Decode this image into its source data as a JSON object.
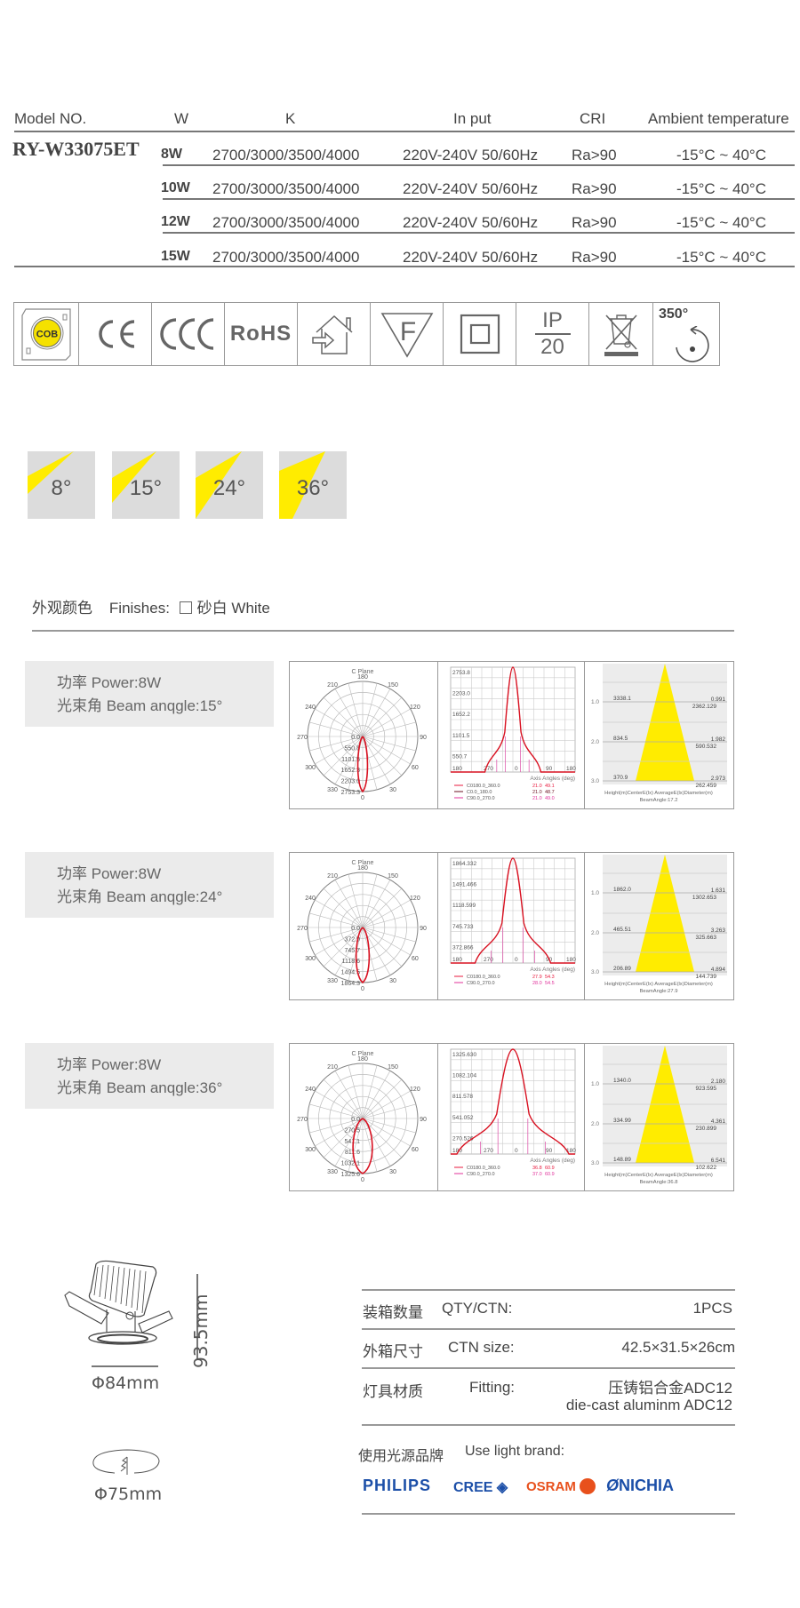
{
  "spec_table": {
    "headers": {
      "model": "Model NO.",
      "w": "W",
      "k": "K",
      "input": "In put",
      "cri": "CRI",
      "ambient": "Ambient temperature"
    },
    "model": "RY-W33075ET",
    "rows": [
      {
        "w": "8W",
        "k": "2700/3000/3500/4000",
        "input": "220V-240V 50/60Hz",
        "cri": "Ra>90",
        "ambient": "-15°C ~ 40°C"
      },
      {
        "w": "10W",
        "k": "2700/3000/3500/4000",
        "input": "220V-240V 50/60Hz",
        "cri": "Ra>90",
        "ambient": "-15°C ~ 40°C"
      },
      {
        "w": "12W",
        "k": "2700/3000/3500/4000",
        "input": "220V-240V 50/60Hz",
        "cri": "Ra>90",
        "ambient": "-15°C ~ 40°C"
      },
      {
        "w": "15W",
        "k": "2700/3000/3500/4000",
        "input": "220V-240V 50/60Hz",
        "cri": "Ra>90",
        "ambient": "-15°C ~ 40°C"
      }
    ]
  },
  "certifications": {
    "icons": [
      "cob-chip-icon",
      "ce-mark-icon",
      "ccc-mark-icon",
      "rohs-icon",
      "indoor-use-icon",
      "f-mark-icon",
      "class-ii-icon",
      "ip20-icon",
      "weee-bin-icon",
      "rotation-icon"
    ],
    "cob_text": "COB",
    "ce_text": "CE",
    "ccc_text": "CCC",
    "rohs_text": "RoHS",
    "f_text": "F",
    "ip_top": "IP",
    "ip_bottom": "20",
    "rotation_text": "350°",
    "colors": {
      "cob_yellow": "#f5e100",
      "icon_gray": "#666666"
    }
  },
  "beam_angles": [
    {
      "label": "8°",
      "angle": 8
    },
    {
      "label": "15°",
      "angle": 15
    },
    {
      "label": "24°",
      "angle": 24
    },
    {
      "label": "36°",
      "angle": 36
    }
  ],
  "finishes": {
    "cn": "外观颜色",
    "en": "Finishes:",
    "option": "砂白 White",
    "checked": false
  },
  "photometrics": [
    {
      "power": "功率 Power:8W",
      "beam": "光束角 Beam anqgle:15°",
      "polar": {
        "title": "C Plane",
        "angle_labels": [
          "180",
          "150",
          "120",
          "90",
          "60",
          "30",
          "0",
          "330",
          "300",
          "270",
          "240",
          "210"
        ],
        "rings": [
          "0.0",
          "550.8",
          "1101.5",
          "1652.3",
          "2203.0",
          "2753.3"
        ]
      },
      "curve": {
        "yticks": [
          "2753.8",
          "2203.0",
          "1652.2",
          "1101.5",
          "550.7"
        ],
        "xticks": [
          "180",
          "270",
          "0",
          "90",
          "180"
        ],
        "axis_label": "Axis Angles (deg)",
        "legend": [
          {
            "name": "C0180.0_360.0",
            "a": "21.0",
            "b": "49.1",
            "color": "#e8183c"
          },
          {
            "name": "C0.0_180.0",
            "a": "21.0",
            "b": "48.7",
            "color": "#6b1020"
          },
          {
            "name": "C90.0_270.0",
            "a": "21.0",
            "b": "49.0",
            "color": "#e0309a"
          }
        ]
      },
      "cone": {
        "rows": [
          {
            "h": "1.0",
            "center": "3338.1",
            "diam": "0.991",
            "avg": "2362.129"
          },
          {
            "h": "2.0",
            "center": "834.5",
            "diam": "1.982",
            "avg": "590.532"
          },
          {
            "h": "3.0",
            "center": "370.9",
            "diam": "2.973",
            "avg": "262.459"
          }
        ],
        "footer": "Height(m)CenterE(lx)     AverageE(lx)Diameter(m)",
        "beam_angle": "BeamAngle:17.2"
      }
    },
    {
      "power": "功率 Power:8W",
      "beam": "光束角 Beam anqgle:24°",
      "polar": {
        "title": "C Plane",
        "angle_labels": [
          "180",
          "150",
          "120",
          "90",
          "60",
          "30",
          "0",
          "330",
          "300",
          "270",
          "240",
          "210"
        ],
        "rings": [
          "0.0",
          "372.9",
          "745.7",
          "1118.6",
          "1494.5",
          "1864.3"
        ]
      },
      "curve": {
        "yticks": [
          "1864.332",
          "1491.466",
          "1118.599",
          "745.733",
          "372.866"
        ],
        "xticks": [
          "180",
          "270",
          "0",
          "90",
          "180"
        ],
        "axis_label": "Axis Angles (deg)",
        "legend": [
          {
            "name": "C0180.0_360.0",
            "a": "27.9",
            "b": "54.3",
            "color": "#e8183c"
          },
          {
            "name": "C90.0_270.0",
            "a": "28.0",
            "b": "54.5",
            "color": "#e0309a"
          }
        ]
      },
      "cone": {
        "rows": [
          {
            "h": "1.0",
            "center": "1862.0",
            "diam": "1.631",
            "avg": "1302.653"
          },
          {
            "h": "2.0",
            "center": "465.51",
            "diam": "3.263",
            "avg": "325.663"
          },
          {
            "h": "3.0",
            "center": "206.89",
            "diam": "4.894",
            "avg": "144.739"
          }
        ],
        "footer": "Height(m)CenterE(lx)     AverageE(lx)Diameter(m)",
        "beam_angle": "BeamAngle:27.9"
      }
    },
    {
      "power": "功率 Power:8W",
      "beam": "光束角 Beam anqgle:36°",
      "polar": {
        "title": "C Plane",
        "angle_labels": [
          "180",
          "150",
          "120",
          "90",
          "60",
          "30",
          "0",
          "330",
          "300",
          "270",
          "240",
          "210"
        ],
        "rings": [
          "0.0",
          "270.5",
          "541.1",
          "811.6",
          "1032.1",
          "1325.6"
        ]
      },
      "curve": {
        "yticks": [
          "1325.630",
          "1082.104",
          "811.578",
          "541.052",
          "270.526"
        ],
        "xticks": [
          "180",
          "270",
          "0",
          "90",
          "180"
        ],
        "axis_label": "Axis Angles (deg)",
        "legend": [
          {
            "name": "C0180.0_360.0",
            "a": "36.8",
            "b": "60.9",
            "color": "#e8183c"
          },
          {
            "name": "C90.0_270.0",
            "a": "37.0",
            "b": "60.9",
            "color": "#e0309a"
          }
        ]
      },
      "cone": {
        "rows": [
          {
            "h": "1.0",
            "center": "1340.0",
            "diam": "2.180",
            "avg": "923.595"
          },
          {
            "h": "2.0",
            "center": "334.99",
            "diam": "4.361",
            "avg": "230.899"
          },
          {
            "h": "3.0",
            "center": "148.89",
            "diam": "6.541",
            "avg": "102.622"
          }
        ],
        "footer": "Height(m)CenterE(lx)     AverageE(lx)Diameter(m)",
        "beam_angle": "BeamAngle:36.8"
      }
    }
  ],
  "dimensions": {
    "height": "93.5mm",
    "diameter": "Φ84mm",
    "cutout": "Φ75mm"
  },
  "packing": {
    "rows": [
      {
        "cn": "装箱数量",
        "en": "QTY/CTN:",
        "value": "1PCS"
      },
      {
        "cn": "外箱尺寸",
        "en": "CTN size:",
        "value": "42.5×31.5×26cm"
      },
      {
        "cn": "灯具材质",
        "en": "Fitting:",
        "value": "压铸铝合金ADC12",
        "value2": "die-cast aluminm ADC12"
      }
    ],
    "brand_cn": "使用光源品牌",
    "brand_en": "Use light brand:",
    "brands": [
      {
        "name": "PHILIPS",
        "color": "#1c4fa8"
      },
      {
        "name": "CREE",
        "color": "#1c4fa8"
      },
      {
        "name": "OSRAM",
        "color": "#e8501c"
      },
      {
        "name": "NICHIA",
        "color": "#1c4fa8"
      }
    ]
  }
}
